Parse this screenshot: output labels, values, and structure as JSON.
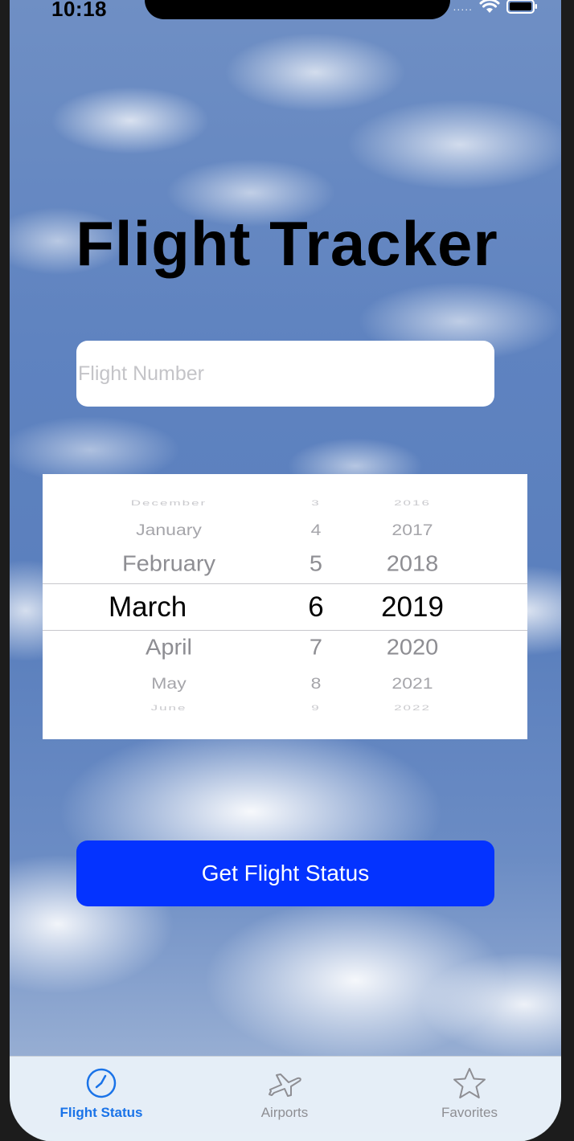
{
  "status_bar": {
    "time": "10:18",
    "signal": "....."
  },
  "app": {
    "title": "Flight Tracker"
  },
  "flight_input": {
    "value": "",
    "placeholder": "Flight Number"
  },
  "date_picker": {
    "months": [
      "December",
      "January",
      "February",
      "March",
      "April",
      "May",
      "June"
    ],
    "days": [
      "3",
      "4",
      "5",
      "6",
      "7",
      "8",
      "9"
    ],
    "years": [
      "2016",
      "2017",
      "2018",
      "2019",
      "2020",
      "2021",
      "2022"
    ],
    "selected": {
      "month": "March",
      "day": "6",
      "year": "2019"
    }
  },
  "submit_button": {
    "label": "Get Flight Status",
    "color": "#0433ff"
  },
  "tab_bar": {
    "items": [
      {
        "label": "Flight Status",
        "icon": "clock-icon",
        "active": true
      },
      {
        "label": "Airports",
        "icon": "airplane-icon",
        "active": false
      },
      {
        "label": "Favorites",
        "icon": "star-icon",
        "active": false
      }
    ],
    "active_color": "#1a73e8",
    "inactive_color": "#8e8e93"
  }
}
